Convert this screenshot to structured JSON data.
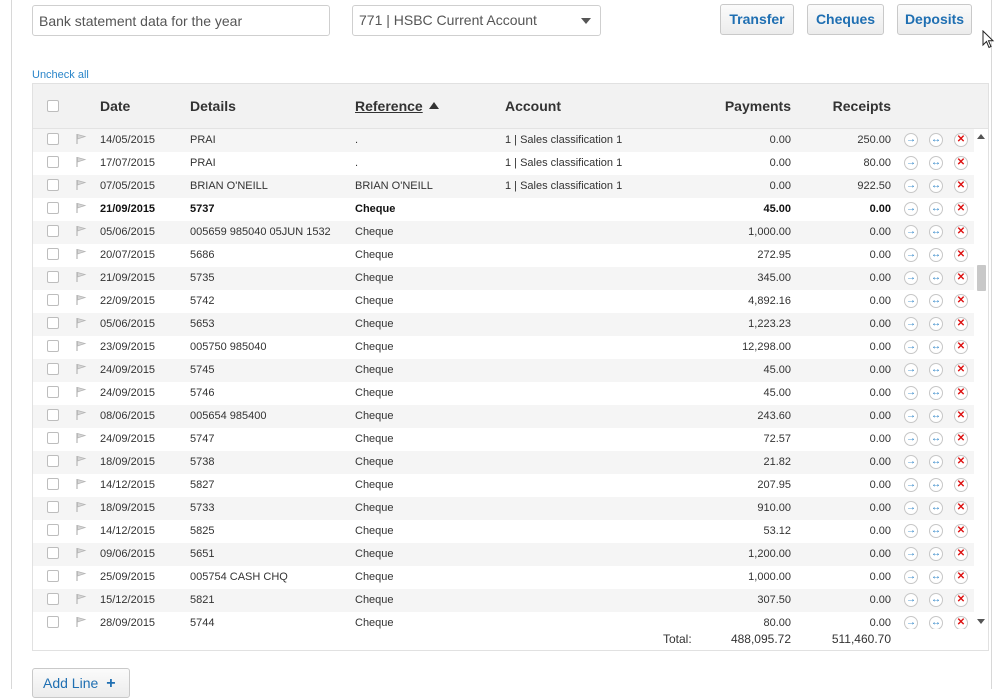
{
  "toolbar": {
    "description_value": "Bank statement data for the year",
    "account_select": "771 | HSBC Current Account",
    "transfer_label": "Transfer",
    "cheques_label": "Cheques",
    "deposits_label": "Deposits"
  },
  "uncheck_all": "Uncheck all",
  "table": {
    "columns": {
      "date": "Date",
      "details": "Details",
      "reference": "Reference",
      "account": "Account",
      "payments": "Payments",
      "receipts": "Receipts"
    },
    "rows": [
      {
        "date": "14/05/2015",
        "details": "PRAI",
        "reference": ".",
        "account": "1 | Sales classification 1",
        "payments": "0.00",
        "receipts": "250.00",
        "bold": false
      },
      {
        "date": "17/07/2015",
        "details": "PRAI",
        "reference": ".",
        "account": "1 | Sales classification 1",
        "payments": "0.00",
        "receipts": "80.00",
        "bold": false
      },
      {
        "date": "07/05/2015",
        "details": "BRIAN O'NEILL",
        "reference": "BRIAN O'NEILL",
        "account": "1 | Sales classification 1",
        "payments": "0.00",
        "receipts": "922.50",
        "bold": false
      },
      {
        "date": "21/09/2015",
        "details": "5737",
        "reference": "Cheque",
        "account": "",
        "payments": "45.00",
        "receipts": "0.00",
        "bold": true
      },
      {
        "date": "05/06/2015",
        "details": "005659 985040 05JUN 1532",
        "reference": "Cheque",
        "account": "",
        "payments": "1,000.00",
        "receipts": "0.00",
        "bold": false
      },
      {
        "date": "20/07/2015",
        "details": "5686",
        "reference": "Cheque",
        "account": "",
        "payments": "272.95",
        "receipts": "0.00",
        "bold": false
      },
      {
        "date": "21/09/2015",
        "details": "5735",
        "reference": "Cheque",
        "account": "",
        "payments": "345.00",
        "receipts": "0.00",
        "bold": false
      },
      {
        "date": "22/09/2015",
        "details": "5742",
        "reference": "Cheque",
        "account": "",
        "payments": "4,892.16",
        "receipts": "0.00",
        "bold": false
      },
      {
        "date": "05/06/2015",
        "details": "5653",
        "reference": "Cheque",
        "account": "",
        "payments": "1,223.23",
        "receipts": "0.00",
        "bold": false
      },
      {
        "date": "23/09/2015",
        "details": "005750 985040",
        "reference": "Cheque",
        "account": "",
        "payments": "12,298.00",
        "receipts": "0.00",
        "bold": false
      },
      {
        "date": "24/09/2015",
        "details": "5745",
        "reference": "Cheque",
        "account": "",
        "payments": "45.00",
        "receipts": "0.00",
        "bold": false
      },
      {
        "date": "24/09/2015",
        "details": "5746",
        "reference": "Cheque",
        "account": "",
        "payments": "45.00",
        "receipts": "0.00",
        "bold": false
      },
      {
        "date": "08/06/2015",
        "details": "005654 985400",
        "reference": "Cheque",
        "account": "",
        "payments": "243.60",
        "receipts": "0.00",
        "bold": false
      },
      {
        "date": "24/09/2015",
        "details": "5747",
        "reference": "Cheque",
        "account": "",
        "payments": "72.57",
        "receipts": "0.00",
        "bold": false
      },
      {
        "date": "18/09/2015",
        "details": "5738",
        "reference": "Cheque",
        "account": "",
        "payments": "21.82",
        "receipts": "0.00",
        "bold": false
      },
      {
        "date": "14/12/2015",
        "details": "5827",
        "reference": "Cheque",
        "account": "",
        "payments": "207.95",
        "receipts": "0.00",
        "bold": false
      },
      {
        "date": "18/09/2015",
        "details": "5733",
        "reference": "Cheque",
        "account": "",
        "payments": "910.00",
        "receipts": "0.00",
        "bold": false
      },
      {
        "date": "14/12/2015",
        "details": "5825",
        "reference": "Cheque",
        "account": "",
        "payments": "53.12",
        "receipts": "0.00",
        "bold": false
      },
      {
        "date": "09/06/2015",
        "details": "5651",
        "reference": "Cheque",
        "account": "",
        "payments": "1,200.00",
        "receipts": "0.00",
        "bold": false
      },
      {
        "date": "25/09/2015",
        "details": "005754 CASH CHQ",
        "reference": "Cheque",
        "account": "",
        "payments": "1,000.00",
        "receipts": "0.00",
        "bold": false
      },
      {
        "date": "15/12/2015",
        "details": "5821",
        "reference": "Cheque",
        "account": "",
        "payments": "307.50",
        "receipts": "0.00",
        "bold": false
      },
      {
        "date": "28/09/2015",
        "details": "5744",
        "reference": "Cheque",
        "account": "",
        "payments": "80.00",
        "receipts": "0.00",
        "bold": false
      }
    ],
    "totals": {
      "label": "Total:",
      "payments": "488,095.72",
      "receipts": "511,460.70"
    }
  },
  "add_line_label": "Add Line",
  "icons": {
    "row_actions": [
      "arrow-right-icon",
      "split-icon",
      "delete-icon"
    ]
  },
  "colors": {
    "accent": "#1f6fb2",
    "delete": "#dd1111",
    "row_alt": "#f5f5f5"
  }
}
